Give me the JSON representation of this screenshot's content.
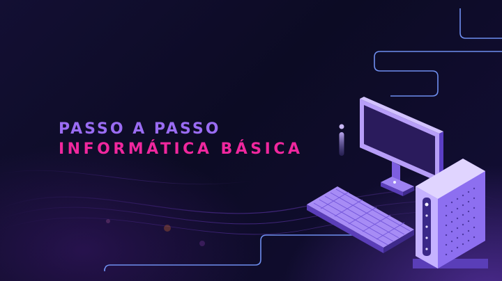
{
  "banner": {
    "title_line1": "PASSO A PASSO",
    "title_line2": "INFORMÁTICA BÁSICA"
  },
  "colors": {
    "background": "#0b0a22",
    "accent_purple": "#9a6cf3",
    "accent_pink": "#f0279e",
    "circuit_line": "#6f8ff0",
    "device_main": "#8a5cf0"
  },
  "icons": [
    "info-icon",
    "monitor-icon",
    "keyboard-icon",
    "router-icon",
    "circuit-lines"
  ]
}
